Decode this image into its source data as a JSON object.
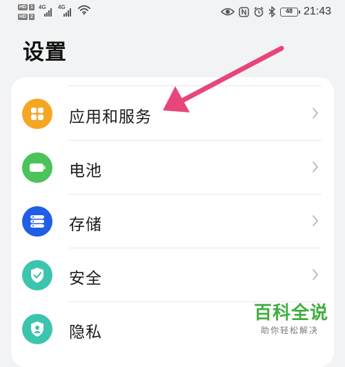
{
  "status_bar": {
    "sim1_tag": "HD",
    "sim1_num": "1",
    "sim2_tag": "HD",
    "sim2_num": "2",
    "network1": "4G",
    "network2": "4G",
    "battery_level": "48",
    "time": "21:43",
    "icons": [
      "wifi-icon",
      "eye-icon",
      "nfc-icon",
      "alarm-icon",
      "bluetooth-icon",
      "battery-icon"
    ]
  },
  "header": {
    "title": "设置"
  },
  "settings_items": [
    {
      "label": "应用和服务",
      "icon": "apps-icon",
      "color": "#f5a623"
    },
    {
      "label": "电池",
      "icon": "battery-icon",
      "color": "#4cc35a"
    },
    {
      "label": "存储",
      "icon": "storage-icon",
      "color": "#1f5ee6"
    },
    {
      "label": "安全",
      "icon": "shield-icon",
      "color": "#3cc5ae"
    },
    {
      "label": "隐私",
      "icon": "privacy-icon",
      "color": "#3cc5ae"
    }
  ],
  "annotation": {
    "arrow_color": "#e8457a"
  },
  "watermark": {
    "title": "百科全说",
    "subtitle": "助你轻松解决",
    "color": "#3fae3f"
  }
}
